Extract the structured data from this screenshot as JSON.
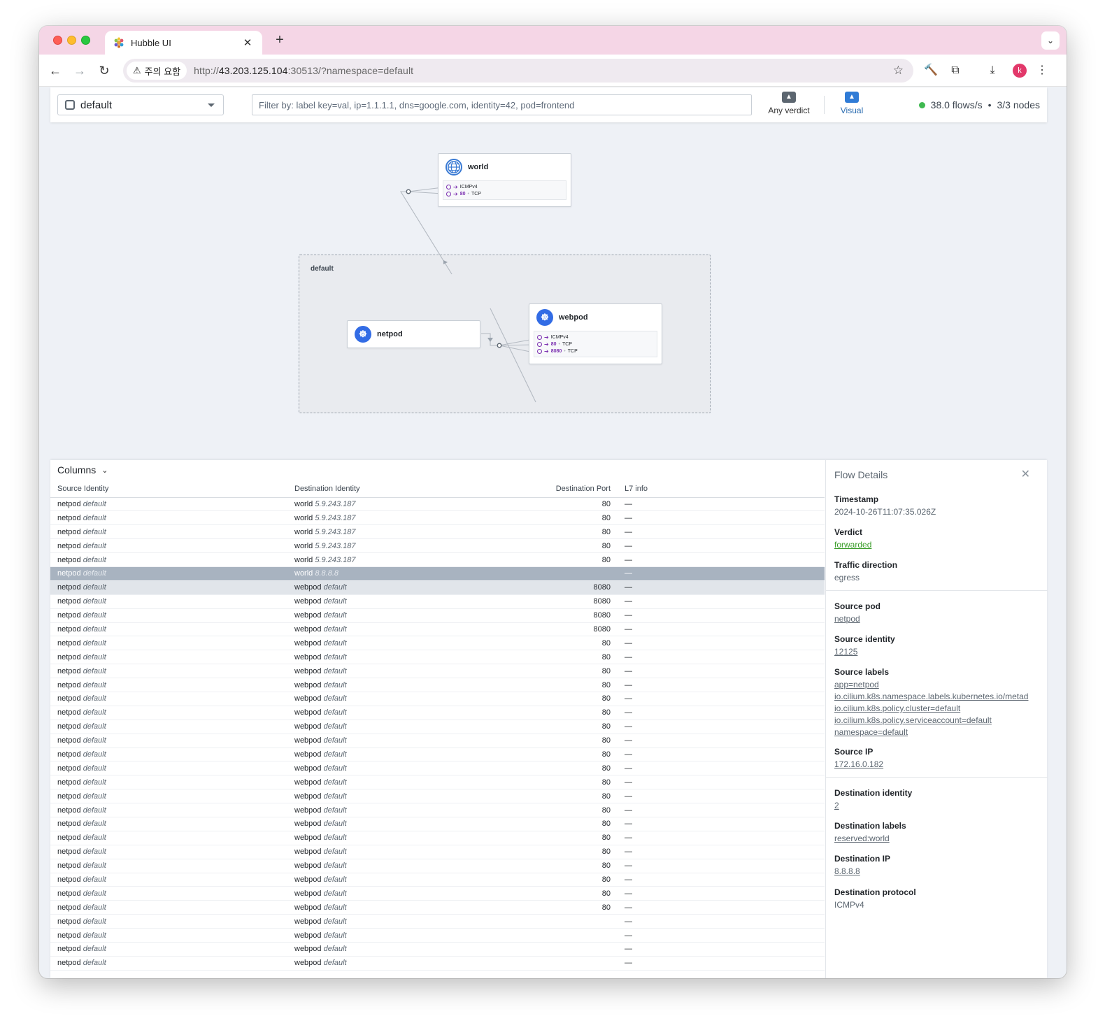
{
  "browser": {
    "tab_title": "Hubble UI",
    "security_label": "주의 요함",
    "url_scheme": "http://",
    "url_host": "43.203.125.104",
    "url_rest": ":30513/?namespace=default",
    "avatar_letter": "k"
  },
  "hubble_bar": {
    "namespace": "default",
    "filter_placeholder": "Filter by: label key=val, ip=1.1.1.1, dns=google.com, identity=42, pod=frontend",
    "verdict_label": "Any verdict",
    "visual_label": "Visual",
    "flow_rate": "38.0 flows/s",
    "separator": "•",
    "nodes": "3/3 nodes"
  },
  "map": {
    "namespace_box_label": "default",
    "world": {
      "name": "world",
      "ports": [
        {
          "port": "",
          "proto": "ICMPv4"
        },
        {
          "port": "80",
          "proto": "TCP"
        }
      ]
    },
    "netpod": {
      "name": "netpod"
    },
    "webpod": {
      "name": "webpod",
      "ports": [
        {
          "port": "",
          "proto": "ICMPv4"
        },
        {
          "port": "80",
          "proto": "TCP"
        },
        {
          "port": "8080",
          "proto": "TCP"
        }
      ]
    }
  },
  "table": {
    "columns_label": "Columns",
    "headers": [
      "Source Identity",
      "Destination Identity",
      "Destination Port",
      "L7 info"
    ],
    "rows": [
      {
        "src": "netpod",
        "src_ns": "default",
        "dst": "world",
        "dst_ns": "5.9.243.187",
        "port": "80",
        "l7": "—"
      },
      {
        "src": "netpod",
        "src_ns": "default",
        "dst": "world",
        "dst_ns": "5.9.243.187",
        "port": "80",
        "l7": "—"
      },
      {
        "src": "netpod",
        "src_ns": "default",
        "dst": "world",
        "dst_ns": "5.9.243.187",
        "port": "80",
        "l7": "—"
      },
      {
        "src": "netpod",
        "src_ns": "default",
        "dst": "world",
        "dst_ns": "5.9.243.187",
        "port": "80",
        "l7": "—"
      },
      {
        "src": "netpod",
        "src_ns": "default",
        "dst": "world",
        "dst_ns": "5.9.243.187",
        "port": "80",
        "l7": "—"
      },
      {
        "src": "netpod",
        "src_ns": "default",
        "dst": "world",
        "dst_ns": "8.8.8.8",
        "port": "",
        "l7": "—",
        "state": "sel"
      },
      {
        "src": "netpod",
        "src_ns": "default",
        "dst": "webpod",
        "dst_ns": "default",
        "port": "8080",
        "l7": "—",
        "state": "hov"
      },
      {
        "src": "netpod",
        "src_ns": "default",
        "dst": "webpod",
        "dst_ns": "default",
        "port": "8080",
        "l7": "—"
      },
      {
        "src": "netpod",
        "src_ns": "default",
        "dst": "webpod",
        "dst_ns": "default",
        "port": "8080",
        "l7": "—"
      },
      {
        "src": "netpod",
        "src_ns": "default",
        "dst": "webpod",
        "dst_ns": "default",
        "port": "8080",
        "l7": "—"
      },
      {
        "src": "netpod",
        "src_ns": "default",
        "dst": "webpod",
        "dst_ns": "default",
        "port": "80",
        "l7": "—"
      },
      {
        "src": "netpod",
        "src_ns": "default",
        "dst": "webpod",
        "dst_ns": "default",
        "port": "80",
        "l7": "—"
      },
      {
        "src": "netpod",
        "src_ns": "default",
        "dst": "webpod",
        "dst_ns": "default",
        "port": "80",
        "l7": "—"
      },
      {
        "src": "netpod",
        "src_ns": "default",
        "dst": "webpod",
        "dst_ns": "default",
        "port": "80",
        "l7": "—"
      },
      {
        "src": "netpod",
        "src_ns": "default",
        "dst": "webpod",
        "dst_ns": "default",
        "port": "80",
        "l7": "—"
      },
      {
        "src": "netpod",
        "src_ns": "default",
        "dst": "webpod",
        "dst_ns": "default",
        "port": "80",
        "l7": "—"
      },
      {
        "src": "netpod",
        "src_ns": "default",
        "dst": "webpod",
        "dst_ns": "default",
        "port": "80",
        "l7": "—"
      },
      {
        "src": "netpod",
        "src_ns": "default",
        "dst": "webpod",
        "dst_ns": "default",
        "port": "80",
        "l7": "—"
      },
      {
        "src": "netpod",
        "src_ns": "default",
        "dst": "webpod",
        "dst_ns": "default",
        "port": "80",
        "l7": "—"
      },
      {
        "src": "netpod",
        "src_ns": "default",
        "dst": "webpod",
        "dst_ns": "default",
        "port": "80",
        "l7": "—"
      },
      {
        "src": "netpod",
        "src_ns": "default",
        "dst": "webpod",
        "dst_ns": "default",
        "port": "80",
        "l7": "—"
      },
      {
        "src": "netpod",
        "src_ns": "default",
        "dst": "webpod",
        "dst_ns": "default",
        "port": "80",
        "l7": "—"
      },
      {
        "src": "netpod",
        "src_ns": "default",
        "dst": "webpod",
        "dst_ns": "default",
        "port": "80",
        "l7": "—"
      },
      {
        "src": "netpod",
        "src_ns": "default",
        "dst": "webpod",
        "dst_ns": "default",
        "port": "80",
        "l7": "—"
      },
      {
        "src": "netpod",
        "src_ns": "default",
        "dst": "webpod",
        "dst_ns": "default",
        "port": "80",
        "l7": "—"
      },
      {
        "src": "netpod",
        "src_ns": "default",
        "dst": "webpod",
        "dst_ns": "default",
        "port": "80",
        "l7": "—"
      },
      {
        "src": "netpod",
        "src_ns": "default",
        "dst": "webpod",
        "dst_ns": "default",
        "port": "80",
        "l7": "—"
      },
      {
        "src": "netpod",
        "src_ns": "default",
        "dst": "webpod",
        "dst_ns": "default",
        "port": "80",
        "l7": "—"
      },
      {
        "src": "netpod",
        "src_ns": "default",
        "dst": "webpod",
        "dst_ns": "default",
        "port": "80",
        "l7": "—"
      },
      {
        "src": "netpod",
        "src_ns": "default",
        "dst": "webpod",
        "dst_ns": "default",
        "port": "80",
        "l7": "—"
      },
      {
        "src": "netpod",
        "src_ns": "default",
        "dst": "webpod",
        "dst_ns": "default",
        "port": "",
        "l7": "—"
      },
      {
        "src": "netpod",
        "src_ns": "default",
        "dst": "webpod",
        "dst_ns": "default",
        "port": "",
        "l7": "—"
      },
      {
        "src": "netpod",
        "src_ns": "default",
        "dst": "webpod",
        "dst_ns": "default",
        "port": "",
        "l7": "—"
      },
      {
        "src": "netpod",
        "src_ns": "default",
        "dst": "webpod",
        "dst_ns": "default",
        "port": "",
        "l7": "—"
      }
    ]
  },
  "details": {
    "title": "Flow Details",
    "timestamp_label": "Timestamp",
    "timestamp": "2024-10-26T11:07:35.026Z",
    "verdict_label": "Verdict",
    "verdict": "forwarded",
    "direction_label": "Traffic direction",
    "direction": "egress",
    "source_pod_label": "Source pod",
    "source_pod": "netpod",
    "source_identity_label": "Source identity",
    "source_identity": "12125",
    "source_labels_label": "Source labels",
    "source_labels": [
      "app=netpod",
      "io.cilium.k8s.namespace.labels.kubernetes.io/metad",
      "io.cilium.k8s.policy.cluster=default",
      "io.cilium.k8s.policy.serviceaccount=default",
      "namespace=default"
    ],
    "source_ip_label": "Source IP",
    "source_ip": "172.16.0.182",
    "dest_identity_label": "Destination identity",
    "dest_identity": "2",
    "dest_labels_label": "Destination labels",
    "dest_labels": [
      "reserved:world"
    ],
    "dest_ip_label": "Destination IP",
    "dest_ip": "8.8.8.8",
    "dest_protocol_label": "Destination protocol",
    "dest_protocol": "ICMPv4"
  },
  "colors": {
    "accent": "#2f7bd6",
    "status_ok": "#3fb950",
    "port_purple": "#7b2fb0",
    "selected_row": "#a8b3c0",
    "verdict_green": "#3a9d2a"
  }
}
